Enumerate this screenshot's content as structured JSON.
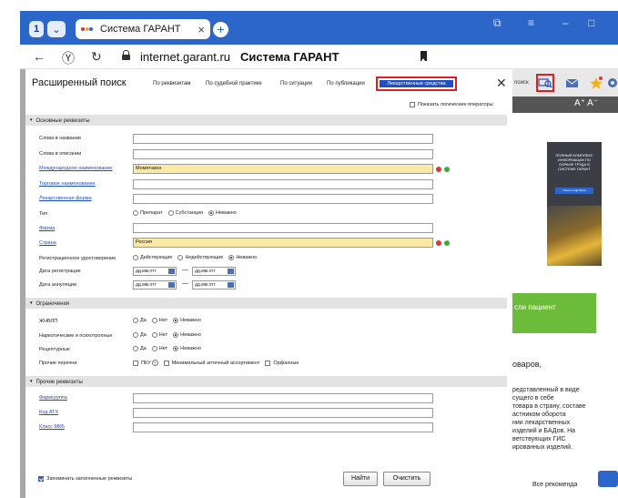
{
  "browser": {
    "tab_title": "Система ГАРАНТ",
    "url": "internet.garant.ru",
    "page_title": "Система ГАРАНТ",
    "accent": "#2d66c9"
  },
  "modal": {
    "title": "Расширенный поиск",
    "tabs": [
      "По реквизитам",
      "По судебной практике",
      "По ситуации",
      "По публикации"
    ],
    "active_tab": "Лекарственные средства",
    "show_logic": "Показать логические операторы",
    "sections": {
      "main": "Основные реквизиты",
      "limits": "Ограничения",
      "other": "Прочие реквизиты"
    },
    "fields": {
      "words_name": "Слова в названии",
      "words_desc": "Слова в описании",
      "intl_name": "Международное наименование",
      "intl_name_value": "Мометазон",
      "trade_name": "Торговое наименование",
      "drug_form": "Лекарственная форма",
      "type": "Тип",
      "firm": "Фирма",
      "country": "Страна",
      "country_value": "Россия",
      "reg_cert": "Регистрационное удостоверение",
      "reg_date": "Дата регистрации",
      "cancel_date": "Дата аннуляции",
      "jnvlp": "ЖНВЛП",
      "narcotic": "Наркотические и психотропные",
      "prescription": "Рецептурные",
      "other_lists": "Прочие перечни",
      "pharm_group": "Фармгруппа",
      "atc": "Код АТХ",
      "icd": "Класс МКБ"
    },
    "type_options": [
      "Препарат",
      "Субстанция",
      "Неважно"
    ],
    "cert_options": [
      "Действующие",
      "Недействующие",
      "Неважно"
    ],
    "yn_options": [
      "Да",
      "Нет",
      "Неважно"
    ],
    "lists_options": {
      "pku": "ПКУ",
      "help": "?",
      "min": "Минимальный аптечный ассортимент",
      "orphan": "Орфанные"
    },
    "date_placeholder": "дд.мм.гггг",
    "date_dash": "—",
    "remember": "Запоминать заполненные реквизиты",
    "find": "Найти",
    "clear": "Очистить"
  },
  "background_page": {
    "search_label": "поиск",
    "text_size": "A⁺ A⁻",
    "ad_text": "ПОЛНЫЙ КОМПЛЕКС ИНФОРМАЦИИ ПО ОХРАНЕ ТРУДА В СИСТЕМЕ ГАРАНТ",
    "ad_button": "Узнать подробнее",
    "green_text": "сли пациент",
    "para1": "оваров,",
    "para2": [
      "редставленный в виде",
      "сущего в себе",
      "товара в страну, составе",
      "астником оборота",
      "нии лекарственных",
      "изделий и БАДов. На",
      "ветствующих ГИС",
      "ированных изделий."
    ],
    "bottom": "Все рекоменда"
  }
}
